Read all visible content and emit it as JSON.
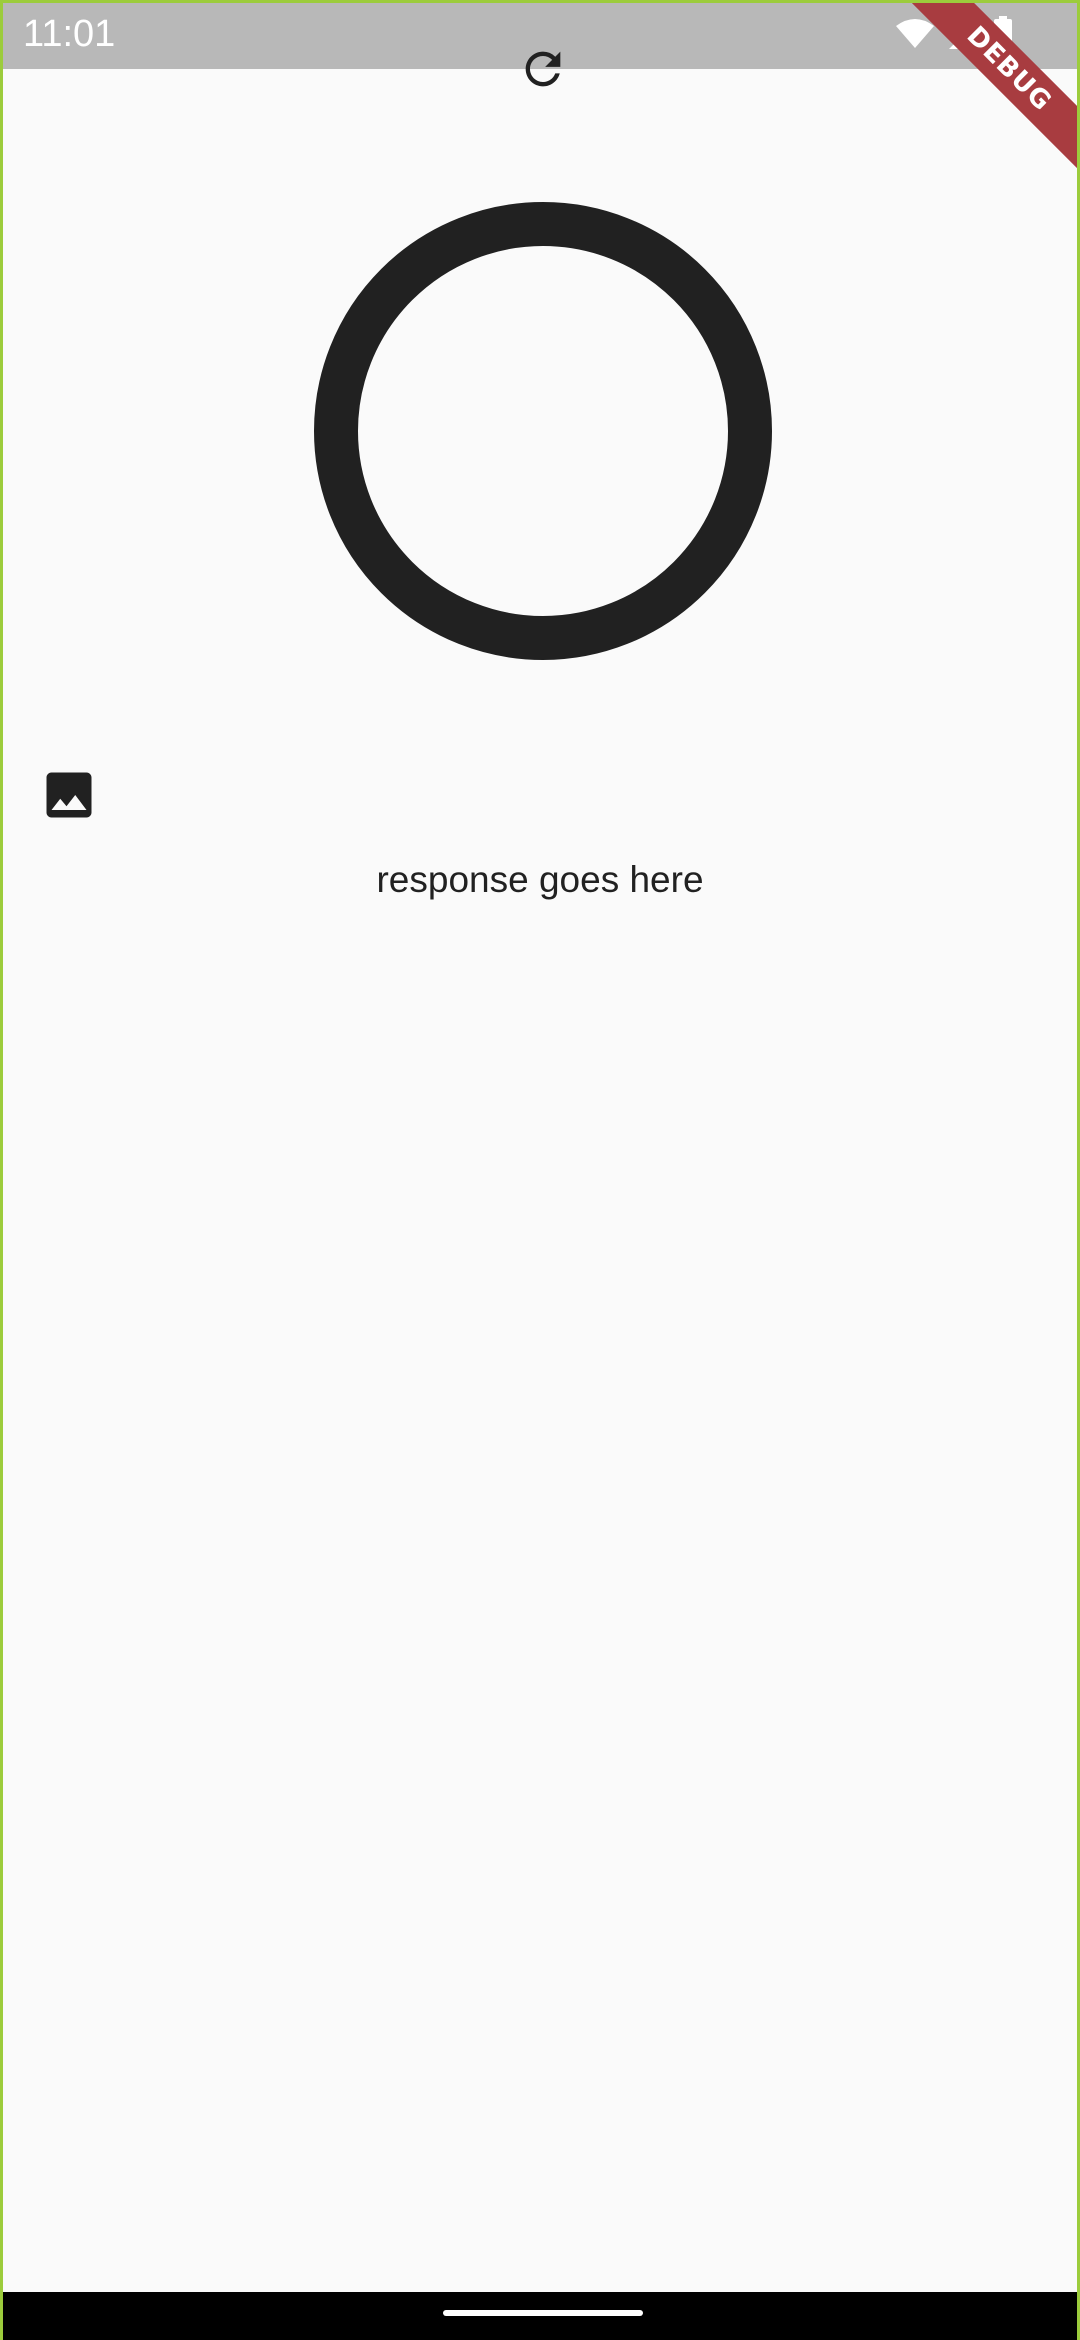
{
  "status_bar": {
    "time": "11:01",
    "icons": [
      "wifi-icon",
      "signal-icon",
      "battery-icon"
    ]
  },
  "debug_banner": {
    "label": "DEBUG",
    "color": "#a83c40"
  },
  "toolbar": {
    "refresh_icon": "refresh-icon"
  },
  "main": {
    "ring_color": "#212121",
    "image_icon": "image-icon",
    "response_text": "response goes here"
  },
  "theme": {
    "background": "#fafafa",
    "status_bar_color": "#b8b8b8",
    "border_color": "#9ccc3c"
  }
}
